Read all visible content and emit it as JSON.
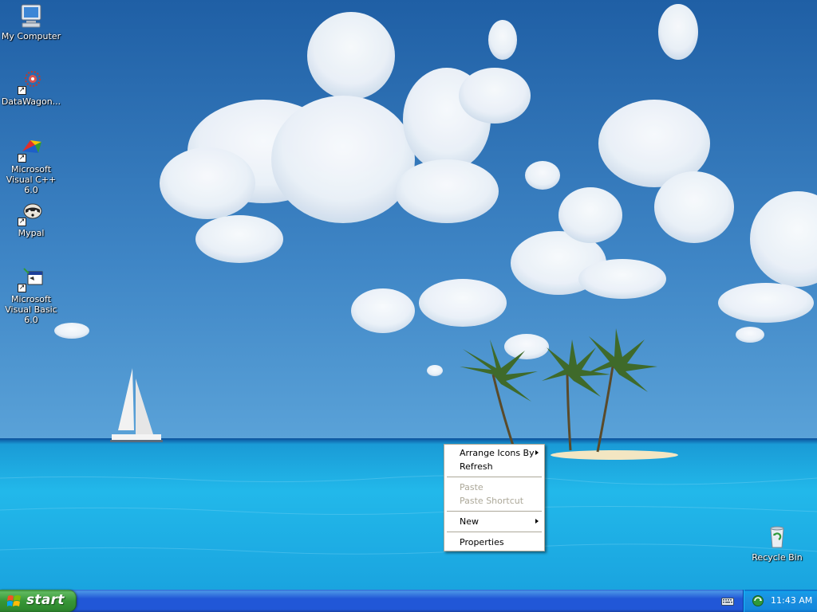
{
  "desktop": {
    "icons": [
      {
        "label": "My Computer",
        "icon": "my-computer-icon"
      },
      {
        "label": "DataWagon...",
        "icon": "datawagon-icon"
      },
      {
        "label": "Microsoft Visual C++ 6.0",
        "icon": "visual-cpp-icon"
      },
      {
        "label": "Mypal",
        "icon": "mypal-icon"
      },
      {
        "label": "Microsoft Visual Basic 6.0",
        "icon": "visual-basic-icon"
      },
      {
        "label": "Recycle Bin",
        "icon": "recycle-bin-icon"
      }
    ]
  },
  "context_menu": {
    "items": [
      {
        "label": "Arrange Icons By",
        "submenu": true,
        "enabled": true
      },
      {
        "label": "Refresh",
        "submenu": false,
        "enabled": true
      },
      {
        "label": "Paste",
        "submenu": false,
        "enabled": false
      },
      {
        "label": "Paste Shortcut",
        "submenu": false,
        "enabled": false
      },
      {
        "label": "New",
        "submenu": true,
        "enabled": true
      },
      {
        "label": "Properties",
        "submenu": false,
        "enabled": true
      }
    ]
  },
  "taskbar": {
    "start_label": "start",
    "clock": "11:43 AM"
  },
  "colors": {
    "taskbar_blue": "#2157d7",
    "start_green": "#379637",
    "tray_blue": "#1489dd",
    "menu_disabled": "#aca899"
  }
}
